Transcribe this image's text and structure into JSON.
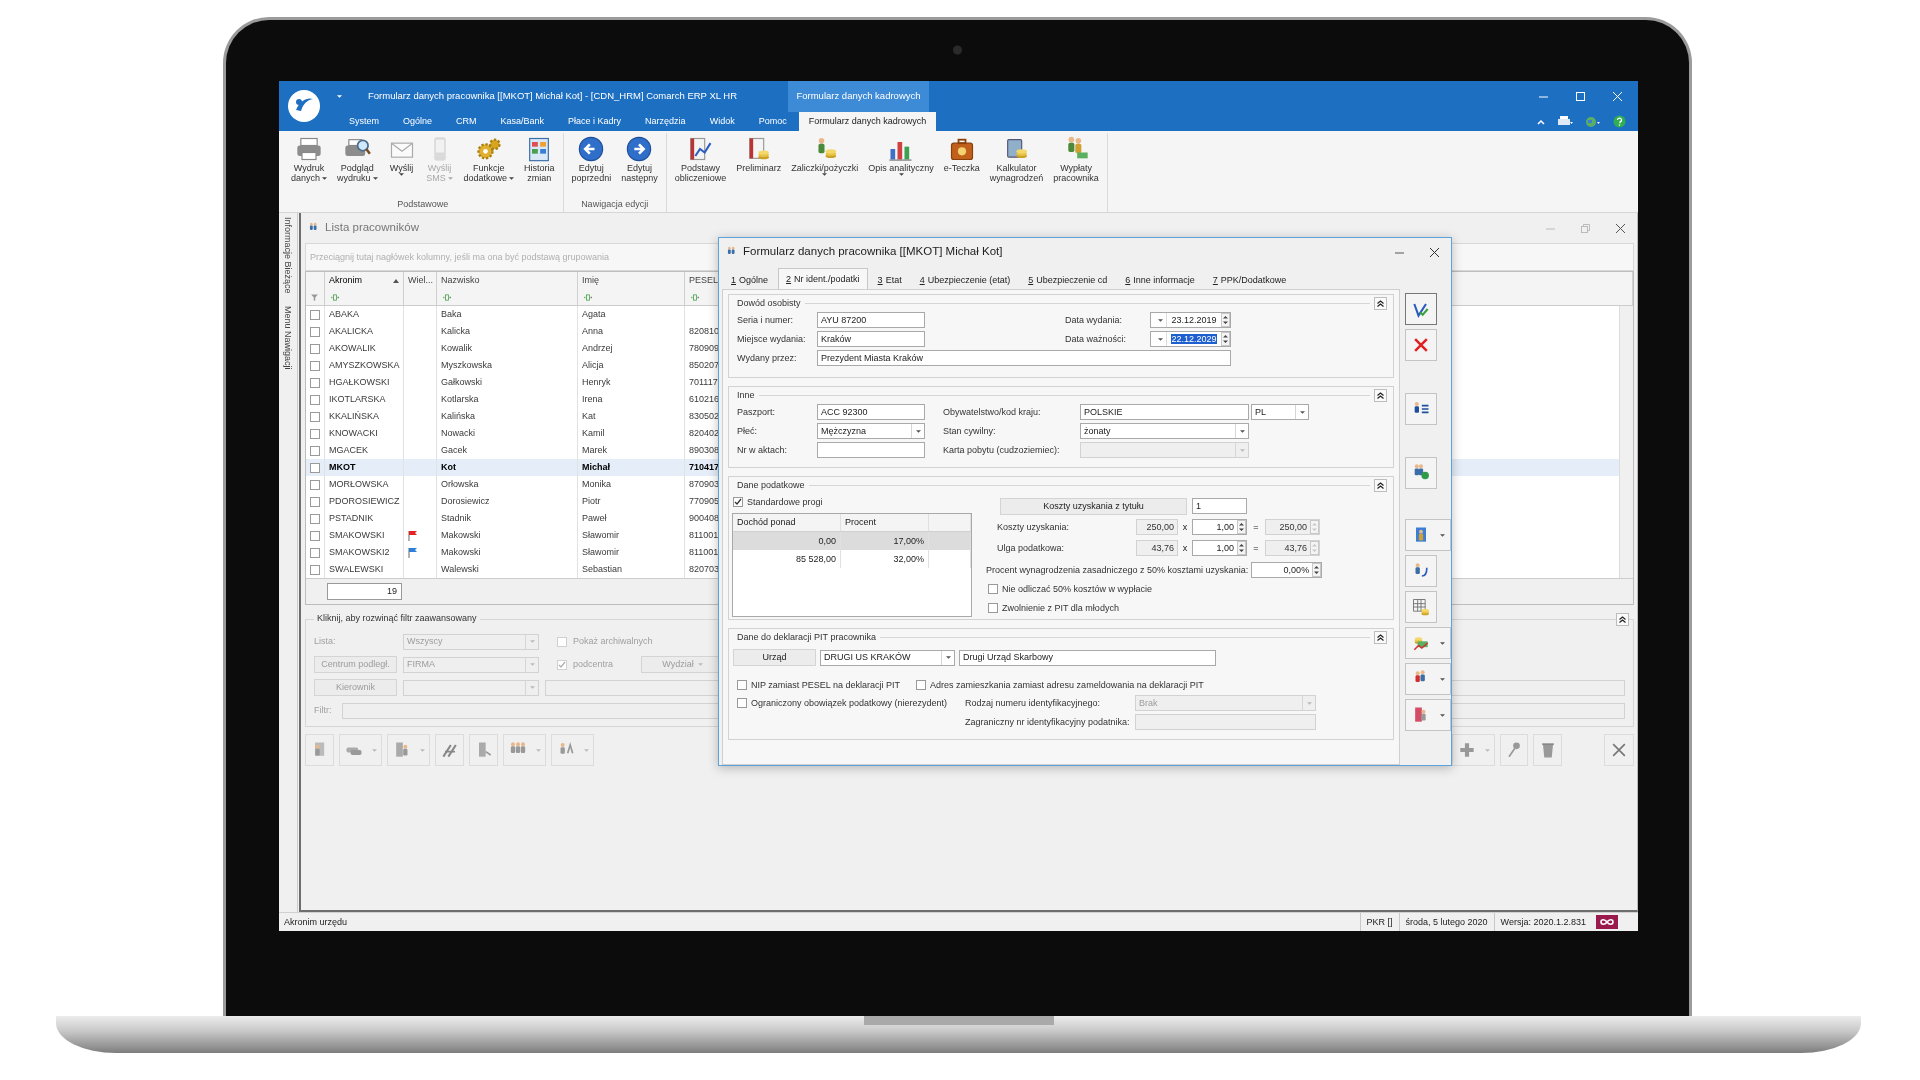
{
  "app": {
    "title": "Formularz danych pracownika [[MKOT] Michał Kot] - [CDN_HRM] Comarch ERP XL HR",
    "context_header": "Formularz danych kadrowych",
    "menu_tabs": [
      {
        "label": "System",
        "selected": false
      },
      {
        "label": "Ogólne",
        "selected": false
      },
      {
        "label": "CRM",
        "selected": false
      },
      {
        "label": "Kasa/Bank",
        "selected": false
      },
      {
        "label": "Płace i Kadry",
        "selected": false
      },
      {
        "label": "Narzędzia",
        "selected": false
      },
      {
        "label": "Widok",
        "selected": false
      },
      {
        "label": "Pomoc",
        "selected": false
      },
      {
        "label": "Formularz danych kadrowych",
        "selected": true
      }
    ]
  },
  "ribbon": {
    "groups": [
      {
        "label": "Podstawowe",
        "buttons": [
          {
            "lines": [
              "Wydruk",
              "danych"
            ],
            "dropdown": true,
            "disabled": false
          },
          {
            "lines": [
              "Podgląd",
              "wydruku"
            ],
            "dropdown": true,
            "disabled": false
          },
          {
            "lines": [
              "Wyślij"
            ],
            "dropdown": true,
            "disabled": false
          },
          {
            "lines": [
              "Wyślij",
              "SMS"
            ],
            "dropdown": true,
            "disabled": true
          },
          {
            "lines": [
              "Funkcje",
              "dodatkowe"
            ],
            "dropdown": true,
            "disabled": false
          },
          {
            "lines": [
              "Historia",
              "zmian"
            ],
            "dropdown": false,
            "disabled": false
          }
        ]
      },
      {
        "label": "Nawigacja edycji",
        "buttons": [
          {
            "lines": [
              "Edytuj",
              "poprzedni"
            ],
            "dropdown": false,
            "disabled": false
          },
          {
            "lines": [
              "Edytuj",
              "następny"
            ],
            "dropdown": false,
            "disabled": false
          }
        ]
      },
      {
        "buttons": [
          {
            "lines": [
              "Podstawy",
              "obliczeniowe"
            ],
            "dropdown": false,
            "disabled": false
          },
          {
            "lines": [
              "Preliminarz"
            ],
            "dropdown": false,
            "disabled": false
          },
          {
            "lines": [
              "Zaliczki/pożyczki"
            ],
            "dropdown": true,
            "disabled": false
          },
          {
            "lines": [
              "Opis analityczny"
            ],
            "dropdown": true,
            "disabled": false
          },
          {
            "lines": [
              "e-Teczka"
            ],
            "dropdown": false,
            "disabled": false
          },
          {
            "lines": [
              "Kalkulator",
              "wynagrodzeń"
            ],
            "dropdown": false,
            "disabled": false
          },
          {
            "lines": [
              "Wypłaty",
              "pracownika"
            ],
            "dropdown": false,
            "disabled": false
          }
        ]
      }
    ]
  },
  "side_tabs": [
    "Informacje Bieżące",
    "Menu Nawigacji"
  ],
  "list": {
    "title": "Lista pracowników",
    "group_hint": "Przeciągnij tutaj nagłówek kolumny, jeśli ma ona być podstawą grupowania",
    "columns": [
      {
        "label": "Akronim",
        "sorted": true
      },
      {
        "label": "Wiel...",
        "sorted": false
      },
      {
        "label": "Nazwisko",
        "sorted": false
      },
      {
        "label": "Imię",
        "sorted": false
      },
      {
        "label": "PESEL",
        "sorted": false
      }
    ],
    "rows": [
      {
        "checked": false,
        "selected": false,
        "akronim": "ABAKA",
        "nazwisko": "Baka",
        "imie": "Agata"
      },
      {
        "checked": false,
        "selected": false,
        "akronim": "AKALICKA",
        "nazwisko": "Kalicka",
        "imie": "Anna",
        "pesel": "820810"
      },
      {
        "checked": false,
        "selected": false,
        "akronim": "AKOWALIK",
        "nazwisko": "Kowalik",
        "imie": "Andrzej",
        "pesel": "780909"
      },
      {
        "checked": false,
        "selected": false,
        "akronim": "AMYSZKOWSKA",
        "nazwisko": "Myszkowska",
        "imie": "Alicja",
        "pesel": "850207"
      },
      {
        "checked": false,
        "selected": false,
        "akronim": "HGAŁKOWSKI",
        "nazwisko": "Gałkowski",
        "imie": "Henryk",
        "pesel": "701117"
      },
      {
        "checked": false,
        "selected": false,
        "akronim": "IKOTLARSKA",
        "nazwisko": "Kotlarska",
        "imie": "Irena",
        "pesel": "610216"
      },
      {
        "checked": false,
        "selected": false,
        "akronim": "KKALIŃSKA",
        "nazwisko": "Kalińska",
        "imie": "Kat",
        "pesel": "830502"
      },
      {
        "checked": false,
        "selected": false,
        "akronim": "KNOWACKI",
        "nazwisko": "Nowacki",
        "imie": "Kamil",
        "pesel": "820402"
      },
      {
        "checked": false,
        "selected": false,
        "akronim": "MGACEK",
        "nazwisko": "Gacek",
        "imie": "Marek",
        "pesel": "890308"
      },
      {
        "checked": false,
        "selected": true,
        "akronim": "MKOT",
        "nazwisko": "Kot",
        "imie": "Michał",
        "pesel": "710417"
      },
      {
        "checked": false,
        "selected": false,
        "akronim": "MORŁOWSKA",
        "nazwisko": "Orłowska",
        "imie": "Monika",
        "pesel": "870903"
      },
      {
        "checked": false,
        "selected": false,
        "akronim": "PDOROSIEWICZ",
        "nazwisko": "Dorosiewicz",
        "imie": "Piotr",
        "pesel": "770905"
      },
      {
        "checked": false,
        "selected": false,
        "akronim": "PSTADNIK",
        "nazwisko": "Stadnik",
        "imie": "Paweł",
        "pesel": "900408"
      },
      {
        "checked": false,
        "selected": false,
        "akronim": "SMAKOWSKI",
        "color": "#e52222",
        "nazwisko": "Makowski",
        "imie": "Sławomir",
        "pesel": "811001"
      },
      {
        "checked": false,
        "selected": false,
        "akronim": "SMAKOWSKI2",
        "color": "#2f7fd8",
        "nazwisko": "Makowski",
        "imie": "Sławomir",
        "pesel": "811001"
      },
      {
        "checked": false,
        "selected": false,
        "akronim": "SWALEWSKI",
        "nazwisko": "Walewski",
        "imie": "Sebastian",
        "pesel": "820703"
      }
    ],
    "count": "19",
    "filter": {
      "legend": "Kliknij, aby rozwinąć filtr zaawansowany",
      "list_label": "Lista:",
      "list_value": "Wszyscy",
      "archive": {
        "label": "Pokaż archiwalnych",
        "checked": false
      },
      "center_button": "Centrum podległ.",
      "center_value": "FIRMA",
      "subcenters": {
        "label": "podcentra",
        "checked": true
      },
      "department_button": "Wydział",
      "manager_button": "Kierownik",
      "filter_label": "Filtr:"
    }
  },
  "dialog": {
    "title": "Formularz danych pracownika [[MKOT] Michał Kot]",
    "tabs": [
      {
        "key": "1",
        "label": "Ogólne",
        "selected": false
      },
      {
        "key": "2",
        "label": "Nr ident./podatki",
        "selected": true
      },
      {
        "key": "3",
        "label": "Etat",
        "selected": false
      },
      {
        "key": "4",
        "label": "Ubezpieczenie (etat)",
        "selected": false
      },
      {
        "key": "5",
        "label": "Ubezpieczenie cd",
        "selected": false
      },
      {
        "key": "6",
        "label": "Inne informacje",
        "selected": false
      },
      {
        "key": "7",
        "label": "PPK/Dodatkowe",
        "selected": false
      }
    ],
    "id_card": {
      "title": "Dowód osobisty",
      "series": {
        "label": "Seria i numer:",
        "value": "AYU 87200"
      },
      "place": {
        "label": "Miejsce wydania:",
        "value": "Kraków"
      },
      "issued_by": {
        "label": "Wydany przez:",
        "value": "Prezydent Miasta Kraków"
      },
      "issue_date": {
        "label": "Data wydania:",
        "value": "23.12.2019",
        "text_selected": false
      },
      "expiry_date": {
        "label": "Data ważności:",
        "value": "22.12.2029",
        "text_selected": true
      }
    },
    "other": {
      "title": "Inne",
      "passport": {
        "label": "Paszport:",
        "value": "ACC 92300"
      },
      "sex": {
        "label": "Płeć:",
        "value": "Mężczyzna"
      },
      "file_no": {
        "label": "Nr w aktach:"
      },
      "citizenship": {
        "label": "Obywatelstwo/kod kraju:",
        "value": "POLSKIE",
        "code": "PL"
      },
      "marital": {
        "label": "Stan cywilny:",
        "value": "żonaty"
      },
      "residence_card": {
        "label": "Karta pobytu (cudzoziemiec):",
        "disabled": true
      }
    },
    "tax": {
      "title": "Dane podatkowe",
      "standard": {
        "label": "Standardowe progi",
        "checked": true
      },
      "thresholds": {
        "columns": [
          "Dochód ponad",
          "Procent"
        ],
        "rows": [
          {
            "income": "0,00",
            "percent": "17,00%",
            "selected": true
          },
          {
            "income": "85 528,00",
            "percent": "32,00%",
            "selected": false
          }
        ]
      },
      "costs_button": "Koszty uzyskania z tytułu",
      "costs_count": "1",
      "calc_rows": [
        {
          "label": "Koszty uzyskania:",
          "base": "250,00",
          "op": "x",
          "factor": "1,00",
          "eq": "=",
          "result": "250,00"
        },
        {
          "label": "Ulga podatkowa:",
          "base": "43,76",
          "op": "x",
          "factor": "1,00",
          "eq": "=",
          "result": "43,76"
        }
      ],
      "percent": {
        "label": "Procent wynagrodzenia zasadniczego z 50% kosztami uzyskania:",
        "value": "0,00%"
      },
      "options": [
        {
          "label": "Nie odliczać 50% kosztów w wypłacie",
          "checked": false
        },
        {
          "label": "Zwolnienie z PIT dla młodych",
          "checked": false
        }
      ]
    },
    "pit": {
      "title": "Dane do deklaracji PIT pracownika",
      "office_button": "Urząd",
      "office_code": "DRUGI US KRAKÓW",
      "office_name": "Drugi Urząd Skarbowy",
      "options": [
        {
          "label": "NIP zamiast PESEL na deklaracji PIT",
          "checked": false
        },
        {
          "label": "Adres zamieszkania zamiast adresu zameldowania na deklaracji PIT",
          "checked": false
        },
        {
          "label": "Ograniczony obowiązek podatkowy (nierezydent)",
          "checked": false
        }
      ],
      "id_type": {
        "label": "Rodzaj numeru identyfikacyjnego:",
        "value": "Brak"
      },
      "foreign_id": {
        "label": "Zagraniczny nr identyfikacyjny podatnika:"
      }
    }
  },
  "status_bar": {
    "left": "Akronim urzędu",
    "items": [
      "PKR []",
      "środa, 5 lutego 2020",
      "Wersja: 2020.1.2.831"
    ]
  }
}
